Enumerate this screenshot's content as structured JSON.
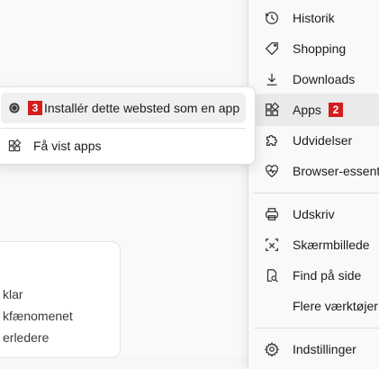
{
  "main_menu": {
    "items": [
      {
        "label": "Historik",
        "icon": "history-icon"
      },
      {
        "label": "Shopping",
        "icon": "tag-icon"
      },
      {
        "label": "Downloads",
        "icon": "download-icon"
      },
      {
        "label": "Apps",
        "icon": "apps-icon",
        "badge": "2",
        "active": true
      },
      {
        "label": "Udvidelser",
        "icon": "puzzle-icon"
      },
      {
        "label": "Browser-essentials",
        "icon": "heartbeat-icon"
      },
      {
        "label": "Udskriv",
        "icon": "printer-icon"
      },
      {
        "label": "Skærmbillede",
        "icon": "screenshot-icon"
      },
      {
        "label": "Find på side",
        "icon": "find-icon"
      },
      {
        "label": "Flere værktøjer",
        "icon": ""
      },
      {
        "label": "Indstillinger",
        "icon": "gear-icon"
      }
    ]
  },
  "apps_submenu": {
    "install_label": "Installér dette websted som en app",
    "install_badge": "3",
    "view_apps_label": "Få vist apps"
  },
  "card": {
    "lines": [
      "klar",
      "kfænomenet",
      "erledere"
    ]
  },
  "colors": {
    "badge": "#d21e1e",
    "menu_bg": "#f9f9f9",
    "active_bg": "#eaeaea"
  }
}
